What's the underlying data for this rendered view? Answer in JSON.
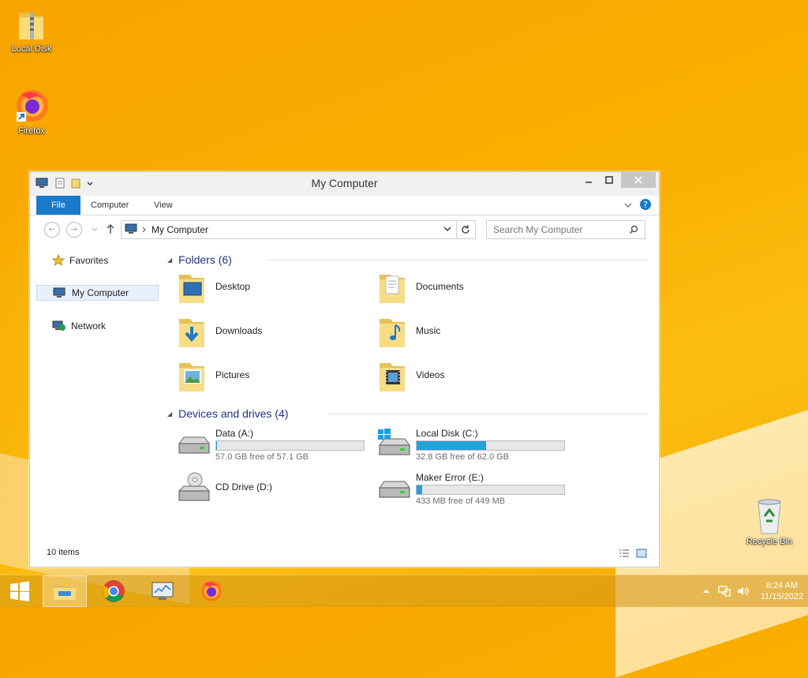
{
  "desktop": {
    "icons": [
      {
        "label": "Local Disk",
        "icon": "folder-zip-icon"
      },
      {
        "label": "Firefox",
        "icon": "firefox-icon"
      },
      {
        "label": "Recycle Bin",
        "icon": "recycle-bin-icon"
      }
    ]
  },
  "window": {
    "title": "My Computer",
    "ribbon_tabs": {
      "file": "File",
      "computer": "Computer",
      "view": "View"
    },
    "address": "My Computer",
    "search_placeholder": "Search My Computer",
    "nav": {
      "favorites": "Favorites",
      "my_computer": "My Computer",
      "network": "Network"
    },
    "folders_header": "Folders (6)",
    "folders": [
      {
        "label": "Desktop",
        "icon": "desktop-folder-icon"
      },
      {
        "label": "Documents",
        "icon": "documents-folder-icon"
      },
      {
        "label": "Downloads",
        "icon": "downloads-folder-icon"
      },
      {
        "label": "Music",
        "icon": "music-folder-icon"
      },
      {
        "label": "Pictures",
        "icon": "pictures-folder-icon"
      },
      {
        "label": "Videos",
        "icon": "videos-folder-icon"
      }
    ],
    "drives_header": "Devices and drives (4)",
    "drives": [
      {
        "name": "Data (A:)",
        "free": "57.0 GB free of 57.1 GB",
        "used_fraction": 0.002
      },
      {
        "name": "Local Disk (C:)",
        "free": "32.8 GB free of 62.0 GB",
        "used_fraction": 0.47
      },
      {
        "name": "CD Drive (D:)"
      },
      {
        "name": "Maker Error (E:)",
        "free": "433 MB free of 449 MB",
        "used_fraction": 0.036
      }
    ],
    "status": "10 items"
  },
  "taskbar": {
    "time": "8:24 AM",
    "date": "11/15/2022"
  },
  "colors": {
    "accent": "#1979ca",
    "drive_fill": "#26a0da",
    "header_text": "#1e3287"
  }
}
